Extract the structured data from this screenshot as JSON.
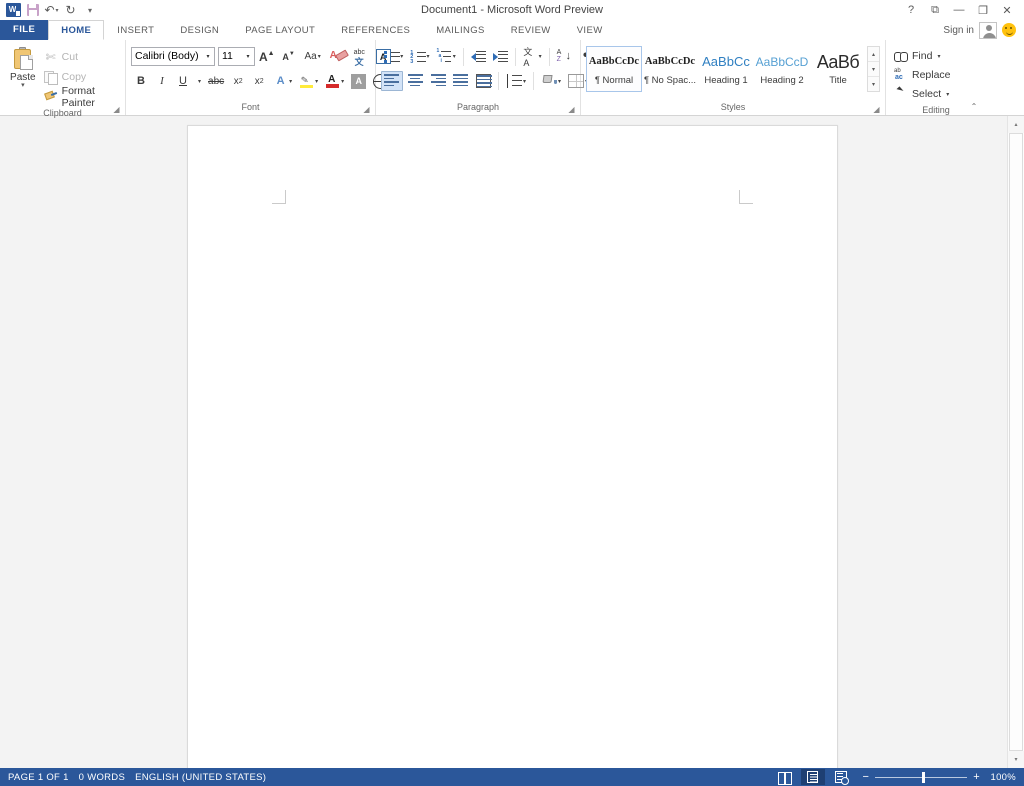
{
  "window": {
    "title": "Document1 - Microsoft Word Preview",
    "quick_access": [
      {
        "name": "word-logo",
        "label": "W"
      },
      {
        "name": "save-icon",
        "label": "Save"
      },
      {
        "name": "undo-icon",
        "label": "↶"
      },
      {
        "name": "redo-icon",
        "label": "↻"
      },
      {
        "name": "customize-qat-icon",
        "label": "☷"
      }
    ],
    "buttons": {
      "help": "?",
      "ribbon_display": "⧉",
      "minimize": "—",
      "restore": "❐",
      "close": "✕"
    },
    "signin_label": "Sign in"
  },
  "tabs": [
    {
      "label": "FILE",
      "active": false,
      "file": true
    },
    {
      "label": "HOME",
      "active": true
    },
    {
      "label": "INSERT",
      "active": false
    },
    {
      "label": "DESIGN",
      "active": false
    },
    {
      "label": "PAGE LAYOUT",
      "active": false
    },
    {
      "label": "REFERENCES",
      "active": false
    },
    {
      "label": "MAILINGS",
      "active": false
    },
    {
      "label": "REVIEW",
      "active": false
    },
    {
      "label": "VIEW",
      "active": false
    }
  ],
  "ribbon": {
    "clipboard": {
      "group_label": "Clipboard",
      "paste_label": "Paste",
      "cut_label": "Cut",
      "copy_label": "Copy",
      "format_painter_label": "Format Painter",
      "dialog_launcher": "⤵"
    },
    "font": {
      "group_label": "Font",
      "font_name_value": "Calibri (Body)",
      "font_size_value": "11",
      "grow_font": "A",
      "shrink_font": "A",
      "change_case": "Aa",
      "clear_formatting": "A",
      "phonetic_guide_top": "abc",
      "phonetic_guide_bottom": "文",
      "character_border": "A",
      "bold": "B",
      "italic": "I",
      "underline": "U",
      "strikethrough": "abc",
      "subscript_base": "x",
      "subscript_sup": "2",
      "superscript_base": "x",
      "superscript_sup": "2",
      "text_effects": "A",
      "text_highlight": "ab",
      "font_color": "A",
      "character_shading": "A",
      "enclose_characters": "字",
      "dialog_launcher": "⤵"
    },
    "paragraph": {
      "group_label": "Paragraph",
      "bullets": "•",
      "numbering": "1.",
      "multilevel_list": "≡",
      "decrease_indent": "←",
      "increase_indent": "→",
      "asian_layout": "文A",
      "sort": "A↓",
      "show_marks": "¶",
      "align_left": "≡",
      "center": "≡",
      "align_right": "≡",
      "justify": "≡",
      "distributed": "≡",
      "line_spacing": "↕",
      "shading": "■",
      "borders": "⊞",
      "dialog_launcher": "⤵"
    },
    "styles": {
      "group_label": "Styles",
      "items": [
        {
          "preview": "AaBbCcDc",
          "name": "¶ Normal",
          "selected": true,
          "variant": "normal"
        },
        {
          "preview": "AaBbCcDc",
          "name": "¶ No Spac...",
          "selected": false,
          "variant": "nospace"
        },
        {
          "preview": "AaBbCс",
          "name": "Heading 1",
          "selected": false,
          "variant": "h1"
        },
        {
          "preview": "AaBbCcD",
          "name": "Heading 2",
          "selected": false,
          "variant": "h2"
        },
        {
          "preview": "AaBб",
          "name": "Title",
          "selected": false,
          "variant": "title"
        }
      ],
      "scroll_up": "▴",
      "scroll_down": "▾",
      "more": "▾",
      "dialog_launcher": "⤵"
    },
    "editing": {
      "group_label": "Editing",
      "find_label": "Find",
      "find_caret": "▾",
      "replace_label": "Replace",
      "select_label": "Select",
      "select_caret": "▾"
    },
    "collapse_ribbon": "⌃"
  },
  "document": {
    "page_background": "#ffffff",
    "canvas_background": "#f3f3f3",
    "content": ""
  },
  "scrollbar": {
    "up_arrow": "▴",
    "down_arrow": "▾",
    "split_button": "▴"
  },
  "status_bar": {
    "page_info": "PAGE 1 OF 1",
    "word_count": "0 WORDS",
    "language": "ENGLISH (UNITED STATES)",
    "views": [
      {
        "name": "read-mode",
        "active": false
      },
      {
        "name": "print-layout",
        "active": true
      },
      {
        "name": "web-layout",
        "active": false
      }
    ],
    "zoom_out": "−",
    "zoom_in": "+",
    "zoom_level": "100%"
  },
  "colors": {
    "accent_blue": "#2b579a",
    "status_bar": "#2b579a",
    "canvas": "#f3f3f3",
    "tab_active_text": "#2b579a"
  }
}
